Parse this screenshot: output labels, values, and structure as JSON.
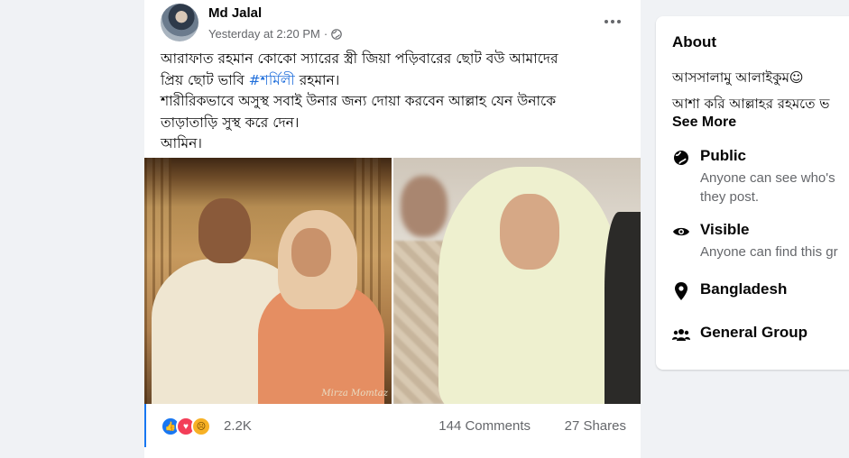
{
  "post": {
    "author": "Md Jalal",
    "time": "Yesterday at 2:20 PM",
    "separator": "·",
    "text": {
      "line1": "আরাফাত রহমান কোকো স্যারের স্ত্রী  জিয়া পড়িবারের ছোট বউ আমাদের",
      "line2_before": "প্রিয় ছোট ভাবি ",
      "hashtag": "#শর্মিলী",
      "line2_after": " রহমান।",
      "line3": "শারীরিকভাবে অসুস্থ সবাই উনার জন্য দোয়া করবেন আল্লাহ যেন উনাকে",
      "line4": "তাড়াতাড়ি সুস্থ করে দেন।",
      "line5": "আমিন।"
    },
    "photo_watermark": "Mirza Momtaz",
    "reactions": {
      "icons": [
        "like-icon",
        "love-icon",
        "sad-icon"
      ],
      "count": "2.2K",
      "comments": "144 Comments",
      "shares": "27 Shares"
    }
  },
  "about": {
    "title": "About",
    "description_line1": "আসসালামু আলাইকুম☺",
    "description_line2": "আশা করি আল্লাহর রহমতে ভ",
    "see_more": "See More",
    "items": [
      {
        "icon": "globe-icon",
        "label": "Public",
        "sub1": "Anyone can see who's",
        "sub2": "they post."
      },
      {
        "icon": "eye-icon",
        "label": "Visible",
        "sub1": "Anyone can find this gr",
        "sub2": ""
      },
      {
        "icon": "location-pin-icon",
        "label": "Bangladesh",
        "sub1": "",
        "sub2": ""
      },
      {
        "icon": "group-icon",
        "label": "General Group",
        "sub1": "",
        "sub2": ""
      }
    ]
  },
  "colors": {
    "hashtag": "#216fdb",
    "like": "#1877f2",
    "love": "#f33e58",
    "sad": "#f7b125",
    "secondary_text": "#65676b",
    "background": "#f0f2f5"
  }
}
